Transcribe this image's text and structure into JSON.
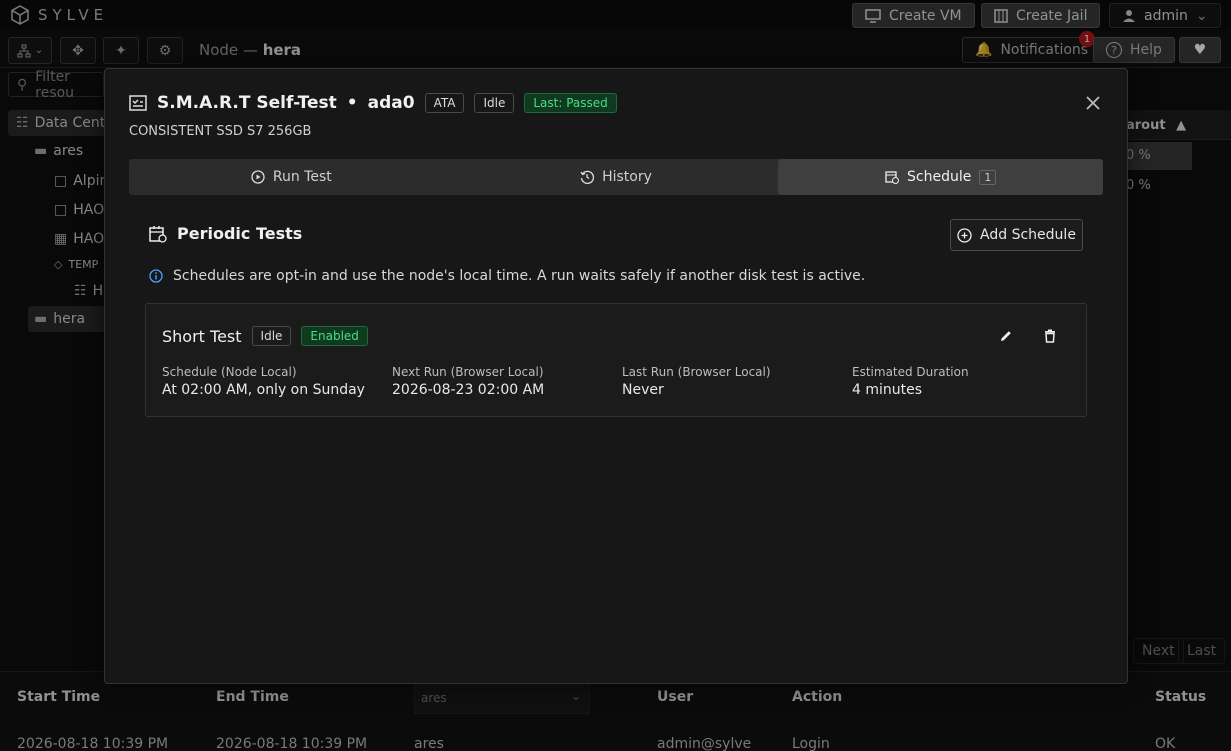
{
  "app": {
    "name": "SYLVE"
  },
  "topbar": {
    "create_vm": "Create VM",
    "create_jail": "Create Jail",
    "user": "admin"
  },
  "toolbar": {
    "breadcrumb_prefix": "Node — ",
    "breadcrumb_node": "hera",
    "notifications": "Notifications",
    "notification_count": "1",
    "help": "Help"
  },
  "sidebar": {
    "filter_placeholder": "Filter resou",
    "items": [
      {
        "label": "Data Cente"
      },
      {
        "label": "ares"
      },
      {
        "label": "Alpin"
      },
      {
        "label": "HAO"
      },
      {
        "label": "HAO"
      },
      {
        "label": "TEMP"
      },
      {
        "label": "H"
      },
      {
        "label": "hera"
      }
    ]
  },
  "background_table": {
    "header": "arout",
    "rows": [
      "0 %",
      "0 %"
    ],
    "pager": [
      "Next",
      "Last"
    ]
  },
  "bottom_table": {
    "columns": [
      "Start Time",
      "End Time",
      "User",
      "Action",
      "Status"
    ],
    "filter_value": "ares",
    "row": {
      "start": "2026-08-18 10:39 PM",
      "end": "2026-08-18 10:39 PM",
      "node": "ares",
      "user": "admin@sylve",
      "action": "Login",
      "status": "OK"
    }
  },
  "modal": {
    "title": "S.M.A.R.T Self-Test",
    "device": "ada0",
    "chips": {
      "type": "ATA",
      "state": "Idle",
      "last": "Last: Passed"
    },
    "subtitle": "CONSISTENT SSD S7 256GB",
    "tabs": [
      {
        "label": "Run Test"
      },
      {
        "label": "History"
      },
      {
        "label": "Schedule",
        "count": "1"
      }
    ],
    "section_title": "Periodic Tests",
    "add_button": "Add Schedule",
    "info": "Schedules are opt-in and use the node's local time. A run waits safely if another disk test is active.",
    "schedule": {
      "name": "Short Test",
      "state": "Idle",
      "enabled": "Enabled",
      "fields": [
        {
          "label": "Schedule (Node Local)",
          "value": "At 02:00 AM, only on Sunday"
        },
        {
          "label": "Next Run (Browser Local)",
          "value": "2026-08-23 02:00 AM"
        },
        {
          "label": "Last Run (Browser Local)",
          "value": "Never"
        },
        {
          "label": "Estimated Duration",
          "value": "4 minutes"
        }
      ]
    }
  },
  "colors": {
    "accent_green": "#4ade80",
    "badge_red": "#b3161a",
    "info_blue": "#4aa3ff"
  }
}
